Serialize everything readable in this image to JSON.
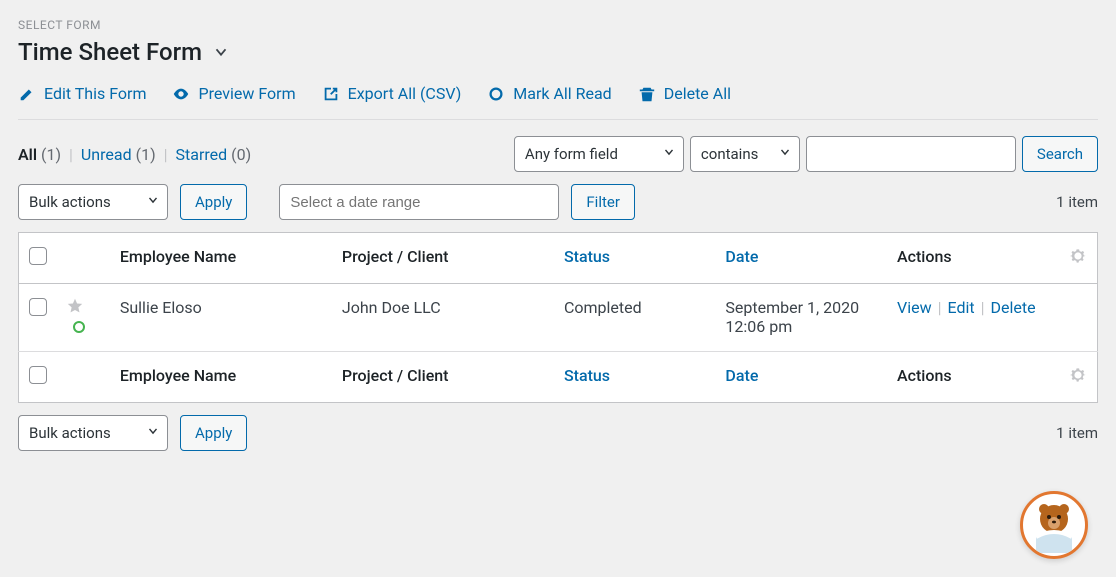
{
  "select_form_label": "SELECT FORM",
  "form_title": "Time Sheet Form",
  "action_links": {
    "edit": "Edit This Form",
    "preview": "Preview Form",
    "export": "Export All (CSV)",
    "mark_read": "Mark All Read",
    "delete_all": "Delete All"
  },
  "tabs": {
    "all_label": "All",
    "all_count": "(1)",
    "unread_label": "Unread",
    "unread_count": "(1)",
    "starred_label": "Starred",
    "starred_count": "(0)"
  },
  "filters": {
    "field_select": "Any form field",
    "operator_select": "contains",
    "search_value": "",
    "search_btn": "Search",
    "bulk_actions": "Bulk actions",
    "apply_btn": "Apply",
    "date_placeholder": "Select a date range",
    "filter_btn": "Filter",
    "item_count": "1 item"
  },
  "table": {
    "headers": {
      "employee_name": "Employee Name",
      "project_client": "Project / Client",
      "status": "Status",
      "date": "Date",
      "actions": "Actions"
    },
    "rows": [
      {
        "employee_name": "Sullie Eloso",
        "project_client": "John Doe LLC",
        "status": "Completed",
        "date": "September 1, 2020 12:06 pm",
        "actions": {
          "view": "View",
          "edit": "Edit",
          "delete": "Delete"
        }
      }
    ]
  }
}
